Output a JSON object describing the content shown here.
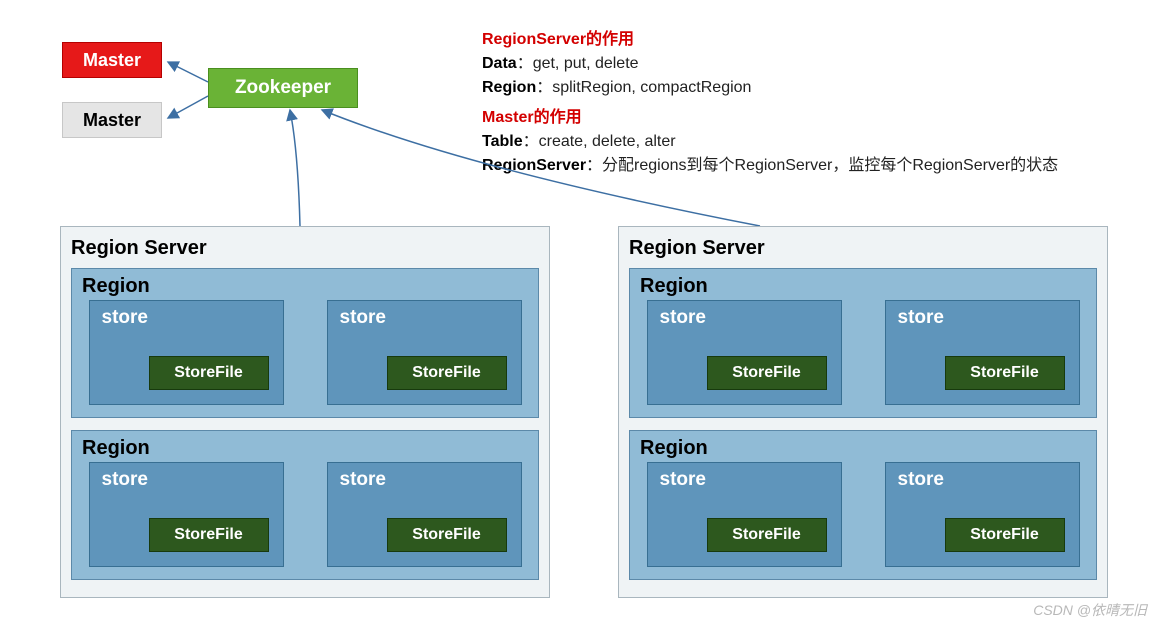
{
  "masters": {
    "active": "Master",
    "standby": "Master"
  },
  "zookeeper": "Zookeeper",
  "desc": {
    "rs_heading": "RegionServer的作用",
    "rs_line1_b": "Data",
    "rs_line1_t": "：get, put, delete",
    "rs_line2_b": "Region",
    "rs_line2_t": "：splitRegion, compactRegion",
    "m_heading": "Master的作用",
    "m_line1_b": "Table",
    "m_line1_t": "：create, delete, alter",
    "m_line2_b": "RegionServer",
    "m_line2_t": "：分配regions到每个RegionServer，监控每个RegionServer的状态"
  },
  "rs_title": "Region Server",
  "region_title": "Region",
  "store_title": "store",
  "storefile_title": "StoreFile",
  "watermark": "CSDN @依晴无旧"
}
